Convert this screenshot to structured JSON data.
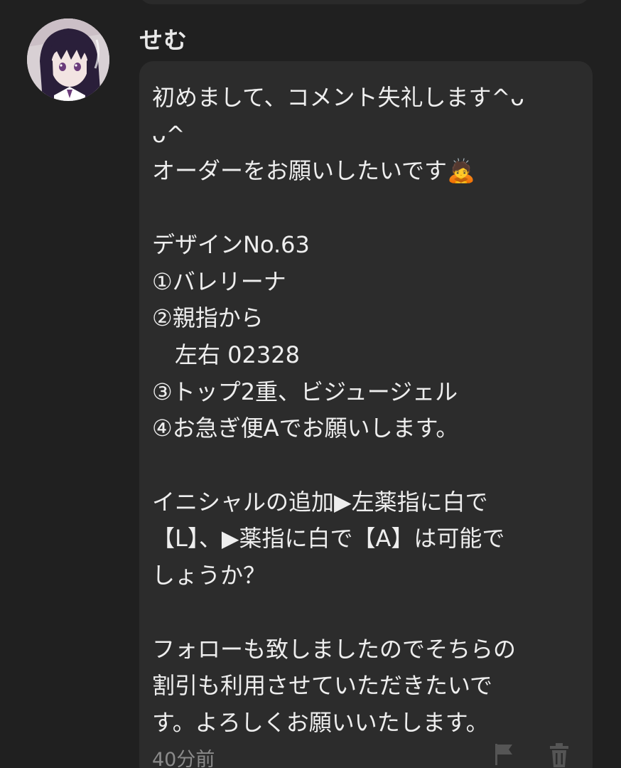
{
  "comment": {
    "username": "せむ",
    "lines": [
      "初めまして、コメント失礼します^ᴗ",
      "ᴗ^",
      "オーダーをお願いしたいです🙇",
      "",
      "デザインNo.63",
      "①バレリーナ",
      "②親指から",
      "　左右 02328",
      "③トップ2重、ビジュージェル",
      "④お急ぎ便Aでお願いします。",
      "",
      "イニシャルの追加▶左薬指に白で",
      "【L】、▶薬指に白で【A】は可能で",
      "しょうか？",
      "",
      "フォローも致しましたのでそちらの",
      "割引も利用させていただきたいで",
      "す。よろしくお願いいたします。"
    ],
    "timestamp": "40分前",
    "actions": {
      "flag_icon": "flag-icon",
      "delete_icon": "trash-icon"
    }
  },
  "colors": {
    "background": "#202020",
    "bubble": "#2c2c2c",
    "text": "#eeeeee",
    "muted": "#8a8a8a"
  }
}
